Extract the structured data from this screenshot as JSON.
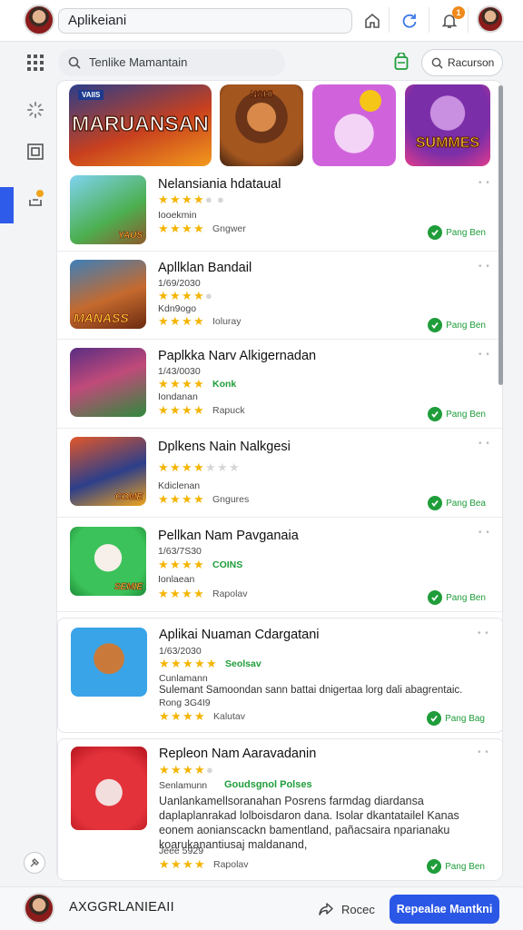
{
  "topbar": {
    "title": "Aplikeiani",
    "notification_count": "1"
  },
  "search": {
    "placeholder": "Tenlike Mamantain"
  },
  "toolbar": {
    "recursion_label": "Racurson"
  },
  "banners": [
    {
      "label": "MARUANSAN",
      "badge": "VAIIS"
    },
    {
      "label": "NAHI"
    },
    {
      "label": ""
    },
    {
      "label": "SUMMES"
    }
  ],
  "apps": [
    {
      "name": "Nelansiania hdataual",
      "meta": "Iooekmin",
      "rating_line_extra": "",
      "stars2_extra": "Gngwer",
      "status": "Pang Ben",
      "icon_tag": "YAUS"
    },
    {
      "name": "Apllklan Bandail",
      "code": "1/69/2030",
      "meta": "Kdn9ogo",
      "stars2_extra": "Ioluray",
      "status": "Pang Ben",
      "icon_tag": "MANASS"
    },
    {
      "name": "Paplkka Narv Alkigernadan",
      "code": "1/43/0030",
      "rating_extra": "Konk",
      "meta": "Iondanan",
      "stars2_extra": "Rapuck",
      "status": "Pang Ben"
    },
    {
      "name": "Dplkens Nain Nalkgesi",
      "meta": "Kdiclenan",
      "stars2_extra": "Gngures",
      "status": "Pang Bea",
      "icon_tag": "COME"
    },
    {
      "name": "Pellkan Nam Pavganaia",
      "code": "1/63/7S30",
      "rating_extra": "COINS",
      "meta": "Ionlaean",
      "stars2_extra": "Rapolav",
      "status": "Pang Ben",
      "icon_tag": "SEMIE"
    },
    {
      "name": "Aplikai Nuaman Cdargatani",
      "code": "1/63/2030",
      "rating_extra": "Seolsav",
      "meta": "Cunlamann",
      "desc": "Sulemant Samoondan sann battai dnigertaa lorg dali abagrentaic.",
      "meta2": "Rong 3G4I9",
      "stars2_extra": "Kalutav",
      "status": "Pang Bag"
    },
    {
      "name": "Repleon Nam Aaravadanin",
      "rating_extra": "Goudsgnol Polses",
      "meta": "Senlamunn",
      "desc": "Uanlankamellsoranahan Posrens farmdag diardansa daplaplanrakad lolboisdaron dana. Isolar dkantatailel Kanas eonem aonianscackn bamentland, pañacsaira nparianaku koarukanantiusaj maldanand,",
      "meta2": "Jeee 5929",
      "stars2_extra": "Rapolav",
      "status": "Pang Ben"
    }
  ],
  "bottombar": {
    "user_name": "AXGGRLANIEAII",
    "share_label": "Rocec",
    "primary_label": "Repealae Mantkni"
  }
}
